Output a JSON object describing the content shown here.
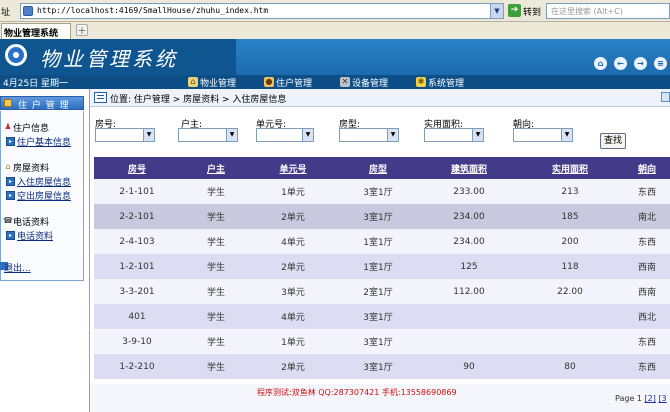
{
  "browser": {
    "address_label": "址",
    "url": "http://localhost:4169/SmallHouse/zhuhu_index.htm",
    "go_label": "转到",
    "search_placeholder": "在这里搜索 (Alt+C)",
    "tab_title": "物业管理系统"
  },
  "banner": {
    "title": "物业管理系统",
    "controls": [
      "home-icon",
      "back-icon",
      "forward-icon",
      "menu-icon"
    ]
  },
  "nav": {
    "date": "4月25日 星期一",
    "items": [
      {
        "label": "物业管理",
        "icon": "house-icon"
      },
      {
        "label": "住户管理",
        "icon": "person-icon"
      },
      {
        "label": "设备管理",
        "icon": "tools-icon"
      },
      {
        "label": "系统管理",
        "icon": "gear-icon"
      }
    ]
  },
  "sidebar": {
    "header": "住 户 管 理",
    "groups": [
      {
        "title": "住户信息",
        "links": [
          "住户基本信息"
        ]
      },
      {
        "title": "房屋资料",
        "links": [
          "入住房屋信息",
          "空出房屋信息"
        ]
      },
      {
        "title": "电话资料",
        "links": [
          "电话资料"
        ]
      }
    ],
    "logout": "退出..."
  },
  "breadcrumb": "位置: 住户管理 > 房屋资料 > 入住房屋信息",
  "filters": [
    {
      "label": "房号:",
      "value": ""
    },
    {
      "label": "户主:",
      "value": ""
    },
    {
      "label": "单元号:",
      "value": ""
    },
    {
      "label": "房型:",
      "value": ""
    },
    {
      "label": "实用面积:",
      "value": ""
    },
    {
      "label": "朝向:",
      "value": ""
    }
  ],
  "search_button": "查找",
  "table": {
    "columns": [
      "房号",
      "户主",
      "单元号",
      "房型",
      "建筑面积",
      "实用面积",
      "朝向"
    ],
    "rows": [
      [
        "2-1-101",
        "学生",
        "1单元",
        "3室1厅",
        "233.00",
        "213",
        "东西"
      ],
      [
        "2-2-101",
        "学生",
        "2单元",
        "3室1厅",
        "234.00",
        "185",
        "南北"
      ],
      [
        "2-4-103",
        "学生",
        "4单元",
        "1室1厅",
        "234.00",
        "200",
        "东西"
      ],
      [
        "1-2-101",
        "学生",
        "2单元",
        "1室1厅",
        "125",
        "118",
        "西南"
      ],
      [
        "3-3-201",
        "学生",
        "3单元",
        "2室1厅",
        "112.00",
        "22.00",
        "西南"
      ],
      [
        "401",
        "学生",
        "4单元",
        "3室1厅",
        "",
        "",
        "西北"
      ],
      [
        "3-9-10",
        "学生",
        "1单元",
        "3室1厅",
        "",
        "",
        "东西"
      ],
      [
        "1-2-210",
        "学生",
        "2单元",
        "3室1厅",
        "90",
        "80",
        "东西"
      ]
    ]
  },
  "footer": {
    "credit": "程序测试:双鱼林 QQ:287307421 手机:13558690869",
    "pager_prefix": "Page 1",
    "pages": [
      "[2]",
      "[3"
    ]
  }
}
